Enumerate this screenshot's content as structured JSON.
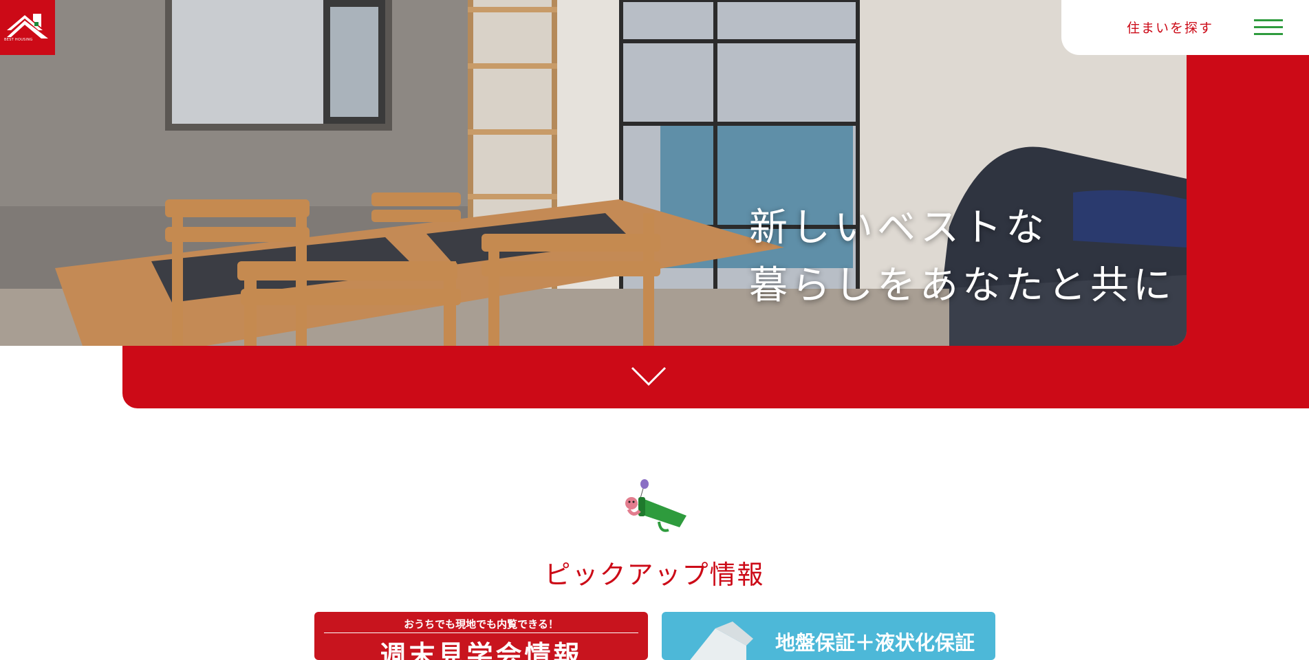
{
  "brand": {
    "logo_text": "BEST HOUSING",
    "colors": {
      "primary_red": "#cc0a17",
      "menu_green": "#2e9b3d",
      "card_blue": "#4db8d8"
    }
  },
  "header": {
    "search_link": "住まいを探す",
    "menu_icon": "hamburger-icon"
  },
  "hero": {
    "line1": "新しいベストな",
    "line2": "暮らしをあなたと共に",
    "scroll_icon": "chevron-down-icon"
  },
  "pickup": {
    "title": "ピックアップ情報",
    "cards": [
      {
        "small": "おうちでも現地でも内覧できる！",
        "big": "週末見学会情報"
      },
      {
        "big": "地盤保証＋液状化保証"
      }
    ]
  }
}
